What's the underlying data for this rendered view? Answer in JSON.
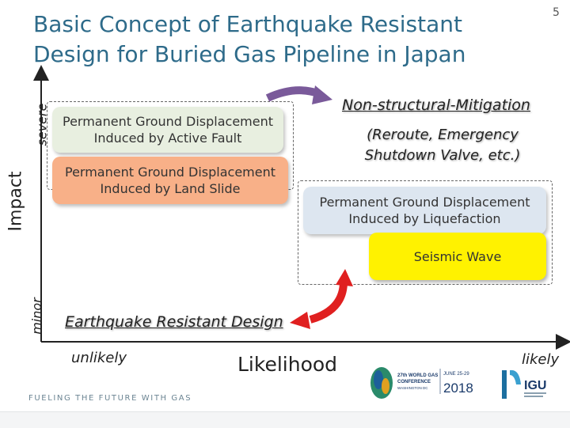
{
  "slide": {
    "title": "Basic Concept of Earthquake Resistant Design for Buried Gas Pipeline in Japan",
    "page_number": "5"
  },
  "axes": {
    "y_label": "Impact",
    "y_high": "severe",
    "y_low": "minor",
    "x_label": "Likelihood",
    "x_low": "unlikely",
    "x_high": "likely"
  },
  "boxes": {
    "active_fault": "Permanent Ground Displacement Induced by Active Fault",
    "land_slide": "Permanent Ground Displacement Induced by Land Slide",
    "liquefaction": "Permanent Ground Displacement Induced by Liquefaction",
    "seismic_wave": "Seismic Wave"
  },
  "strategies": {
    "non_structural": "Non-structural-Mitigation",
    "non_structural_detail": "(Reroute, Emergency Shutdown Valve, etc.)",
    "earthquake_resistant": "Earthquake Resistant Design"
  },
  "footer": {
    "tagline": "FUELING THE FUTURE WITH GAS",
    "conference_logo": {
      "line1": "27th WORLD GAS",
      "line2": "CONFERENCE",
      "line3": "WASHINGTON DC",
      "dates": "JUNE 25-29",
      "year": "2018"
    },
    "igu_logo": "IGU"
  },
  "colors": {
    "title": "#2e6b8a",
    "active_fault_box": "#e8efe0",
    "land_slide_box": "#f8b088",
    "liquefaction_box": "#dde6f0",
    "seismic_wave_box": "#fff200",
    "purple_arrow": "#7a5a9a",
    "red_arrow": "#e02020"
  }
}
